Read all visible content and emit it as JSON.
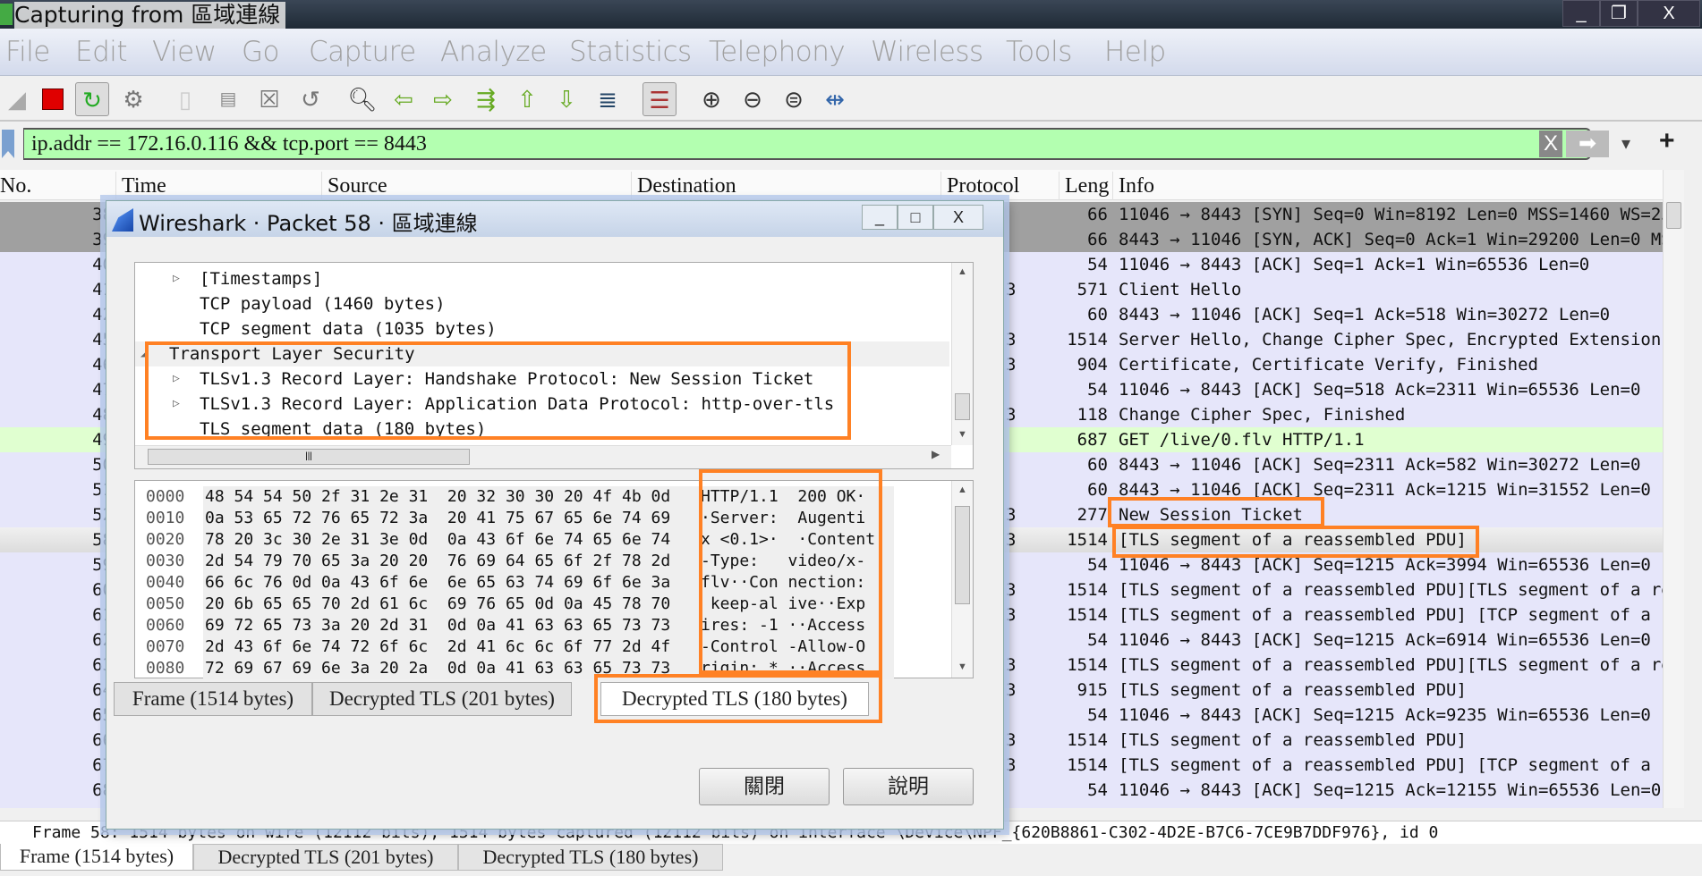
{
  "window": {
    "title": "Capturing from 區域連線",
    "controls": [
      "_",
      "❐",
      "X"
    ]
  },
  "menu": [
    "File",
    "Edit",
    "View",
    "Go",
    "Capture",
    "Analyze",
    "Statistics",
    "Telephony",
    "Wireless",
    "Tools",
    "Help"
  ],
  "toolbar": [
    "shark-fin-start-icon",
    "stop-capture-icon",
    "restart-capture-icon",
    "capture-options-icon",
    "open-file-icon",
    "save-file-icon",
    "close-file-icon",
    "reload-file-icon",
    "find-packet-icon",
    "go-back-icon",
    "go-forward-icon",
    "go-to-packet-icon",
    "first-packet-icon",
    "last-packet-icon",
    "autoscroll-icon",
    "colorize-icon",
    "zoom-in-icon",
    "zoom-out-icon",
    "zoom-normal-icon",
    "resize-columns-icon"
  ],
  "filter": {
    "value": "ip.addr == 172.16.0.116 && tcp.port == 8443",
    "clear": "X",
    "apply": "➡",
    "dropdown": "▾",
    "add": "+"
  },
  "columns": [
    "No.",
    "Time",
    "Source",
    "Destination",
    "Protocol",
    "Leng",
    "Info"
  ],
  "colors": {
    "accent_highlight": "#ff8124",
    "filter_valid": "#b3ffb0",
    "row_tcp_syn": "#a0a0a0",
    "row_tls": "#e6e6fa",
    "row_http": "#e0ffd0",
    "row_selected": "#e6e6e6"
  },
  "packets": [
    {
      "no": "38",
      "proto": "",
      "len": "66",
      "info": "11046 → 8443 [SYN] Seq=0 Win=8192 Len=0 MSS=1460 WS=256…",
      "kind": "syn"
    },
    {
      "no": "39",
      "proto": "",
      "len": "66",
      "info": "8443 → 11046 [SYN, ACK] Seq=0 Ack=1 Win=29200 Len=0 MSS…",
      "kind": "syn"
    },
    {
      "no": "40",
      "proto": "",
      "len": "54",
      "info": "11046 → 8443 [ACK] Seq=1 Ack=1 Win=65536 Len=0",
      "kind": "tls"
    },
    {
      "no": "41",
      "proto": "3",
      "len": "571",
      "info": "Client Hello",
      "kind": "tls"
    },
    {
      "no": "42",
      "proto": "",
      "len": "60",
      "info": "8443 → 11046 [ACK] Seq=1 Ack=518 Win=30272 Len=0",
      "kind": "tls"
    },
    {
      "no": "45",
      "proto": "3",
      "len": "1514",
      "info": "Server Hello, Change Cipher Spec, Encrypted Extensions",
      "kind": "tls"
    },
    {
      "no": "46",
      "proto": "3",
      "len": "904",
      "info": "Certificate, Certificate Verify, Finished",
      "kind": "tls"
    },
    {
      "no": "47",
      "proto": "",
      "len": "54",
      "info": "11046 → 8443 [ACK] Seq=518 Ack=2311 Win=65536 Len=0",
      "kind": "tls"
    },
    {
      "no": "48",
      "proto": "3",
      "len": "118",
      "info": "Change Cipher Spec, Finished",
      "kind": "tls"
    },
    {
      "no": "49",
      "proto": "",
      "len": "687",
      "info": "GET /live/0.flv HTTP/1.1",
      "kind": "http"
    },
    {
      "no": "50",
      "proto": "",
      "len": "60",
      "info": "8443 → 11046 [ACK] Seq=2311 Ack=582 Win=30272 Len=0",
      "kind": "tls"
    },
    {
      "no": "51",
      "proto": "",
      "len": "60",
      "info": "8443 → 11046 [ACK] Seq=2311 Ack=1215 Win=31552 Len=0",
      "kind": "tls"
    },
    {
      "no": "52",
      "proto": "3",
      "len": "277",
      "info": "New Session Ticket",
      "kind": "tls"
    },
    {
      "no": "58",
      "proto": "3",
      "len": "1514",
      "info": "[TLS segment of a reassembled PDU]",
      "kind": "selected"
    },
    {
      "no": "59",
      "proto": "",
      "len": "54",
      "info": "11046 → 8443 [ACK] Seq=1215 Ack=3994 Win=65536 Len=0",
      "kind": "tls"
    },
    {
      "no": "60",
      "proto": "3",
      "len": "1514",
      "info": "[TLS segment of a reassembled PDU][TLS segment of a rea…",
      "kind": "tls"
    },
    {
      "no": "61",
      "proto": "3",
      "len": "1514",
      "info": "[TLS segment of a reassembled PDU] [TCP segment of a re…",
      "kind": "tls"
    },
    {
      "no": "62",
      "proto": "",
      "len": "54",
      "info": "11046 → 8443 [ACK] Seq=1215 Ack=6914 Win=65536 Len=0",
      "kind": "tls"
    },
    {
      "no": "63",
      "proto": "3",
      "len": "1514",
      "info": "[TLS segment of a reassembled PDU][TLS segment of a rea…",
      "kind": "tls"
    },
    {
      "no": "64",
      "proto": "3",
      "len": "915",
      "info": "[TLS segment of a reassembled PDU]",
      "kind": "tls"
    },
    {
      "no": "65",
      "proto": "",
      "len": "54",
      "info": "11046 → 8443 [ACK] Seq=1215 Ack=9235 Win=65536 Len=0",
      "kind": "tls"
    },
    {
      "no": "66",
      "proto": "3",
      "len": "1514",
      "info": "[TLS segment of a reassembled PDU]",
      "kind": "tls"
    },
    {
      "no": "67",
      "proto": "3",
      "len": "1514",
      "info": "[TLS segment of a reassembled PDU] [TCP segment of a re…",
      "kind": "tls"
    },
    {
      "no": "68",
      "proto": "",
      "len": "54",
      "info": "11046 → 8443 [ACK] Seq=1215 Ack=12155 Win=65536 Len=0",
      "kind": "tls"
    }
  ],
  "status": "Frame 58: 1514 bytes on wire (12112 bits), 1514 bytes captured (12112 bits) on interface \\Device\\NPF_{620B8861-C302-4D2E-B7C6-7CE9B7DDF976}, id 0",
  "bottom_tabs": [
    "Frame (1514 bytes)",
    "Decrypted TLS (201 bytes)",
    "Decrypted TLS (180 bytes)"
  ],
  "dialog": {
    "title": "Wireshark · Packet 58 · 區域連線",
    "controls": [
      "_",
      "□",
      "X"
    ],
    "tree": [
      {
        "text": "[Timestamps]",
        "indent": 2,
        "expander": "collapsed"
      },
      {
        "text": "TCP payload (1460 bytes)",
        "indent": 2,
        "expander": "none"
      },
      {
        "text": "TCP segment data (1035 bytes)",
        "indent": 2,
        "expander": "none"
      },
      {
        "text": "Transport Layer Security",
        "indent": 1,
        "expander": "expanded"
      },
      {
        "text": "TLSv1.3 Record Layer: Handshake Protocol: New Session Ticket",
        "indent": 2,
        "expander": "collapsed"
      },
      {
        "text": "TLSv1.3 Record Layer: Application Data Protocol: http-over-tls",
        "indent": 2,
        "expander": "collapsed"
      },
      {
        "text": "TLS segment data (180 bytes)",
        "indent": 2,
        "expander": "none"
      }
    ],
    "hex": [
      {
        "off": "0000",
        "hex": "48 54 54 50 2f 31 2e 31  20 32 30 30 20 4f 4b 0d",
        "ascii": "HTTP/1.1  200 OK·"
      },
      {
        "off": "0010",
        "hex": "0a 53 65 72 76 65 72 3a  20 41 75 67 65 6e 74 69",
        "ascii": "·Server:  Augenti"
      },
      {
        "off": "0020",
        "hex": "78 20 3c 30 2e 31 3e 0d  0a 43 6f 6e 74 65 6e 74",
        "ascii": "x <0.1>·  ·Content"
      },
      {
        "off": "0030",
        "hex": "2d 54 79 70 65 3a 20 20  76 69 64 65 6f 2f 78 2d",
        "ascii": "-Type:   video/x-"
      },
      {
        "off": "0040",
        "hex": "66 6c 76 0d 0a 43 6f 6e  6e 65 63 74 69 6f 6e 3a",
        "ascii": "flv··Con nection:"
      },
      {
        "off": "0050",
        "hex": "20 6b 65 65 70 2d 61 6c  69 76 65 0d 0a 45 78 70",
        "ascii": " keep-al ive··Exp"
      },
      {
        "off": "0060",
        "hex": "69 72 65 73 3a 20 2d 31  0d 0a 41 63 63 65 73 73",
        "ascii": "ires: -1 ··Access"
      },
      {
        "off": "0070",
        "hex": "2d 43 6f 6e 74 72 6f 6c  2d 41 6c 6c 6f 77 2d 4f",
        "ascii": "-Control -Allow-O"
      },
      {
        "off": "0080",
        "hex": "72 69 67 69 6e 3a 20 2a  0d 0a 41 63 63 65 73 73",
        "ascii": "rigin: * ··Access"
      }
    ],
    "tabs": [
      "Frame (1514 bytes)",
      "Decrypted TLS (201 bytes)",
      "Decrypted TLS (180 bytes)"
    ],
    "selected_tab": 2,
    "close_label": "關閉",
    "help_label": "說明"
  }
}
